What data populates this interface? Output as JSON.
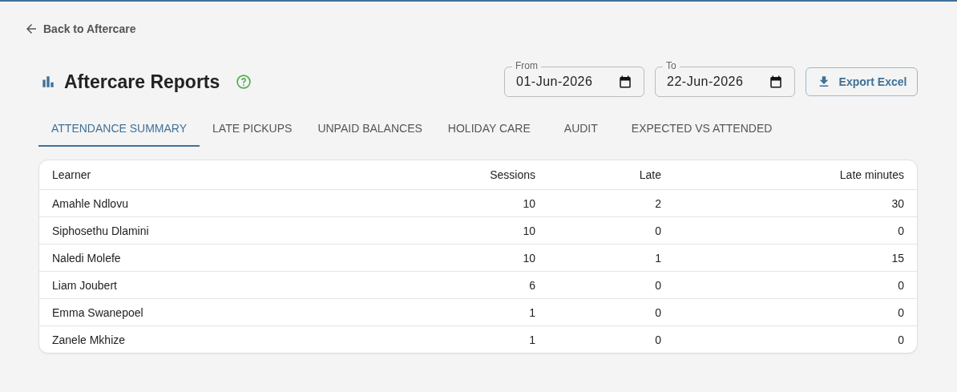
{
  "back_link": "Back to Aftercare",
  "title": "Aftercare Reports",
  "date_range": [
    {
      "label": "From",
      "value": "01-Jun-2026"
    },
    {
      "label": "To",
      "value": "22-Jun-2026"
    }
  ],
  "export_button": "Export Excel",
  "tabs": [
    {
      "label": "ATTENDANCE SUMMARY",
      "selected": true
    },
    {
      "label": "LATE PICKUPS",
      "selected": false
    },
    {
      "label": "UNPAID BALANCES",
      "selected": false
    },
    {
      "label": "HOLIDAY CARE",
      "selected": false
    },
    {
      "label": "AUDIT",
      "selected": false
    },
    {
      "label": "EXPECTED VS ATTENDED",
      "selected": false
    }
  ],
  "table": {
    "columns": [
      "Learner",
      "Sessions",
      "Late",
      "Late minutes"
    ],
    "rows": [
      [
        "Amahle Ndlovu",
        "10",
        "2",
        "30"
      ],
      [
        "Siphosethu Dlamini",
        "10",
        "0",
        "0"
      ],
      [
        "Naledi Molefe",
        "10",
        "1",
        "15"
      ],
      [
        "Liam Joubert",
        "6",
        "0",
        "0"
      ],
      [
        "Emma Swanepoel",
        "1",
        "0",
        "0"
      ],
      [
        "Zanele Mkhize",
        "1",
        "0",
        "0"
      ]
    ]
  }
}
